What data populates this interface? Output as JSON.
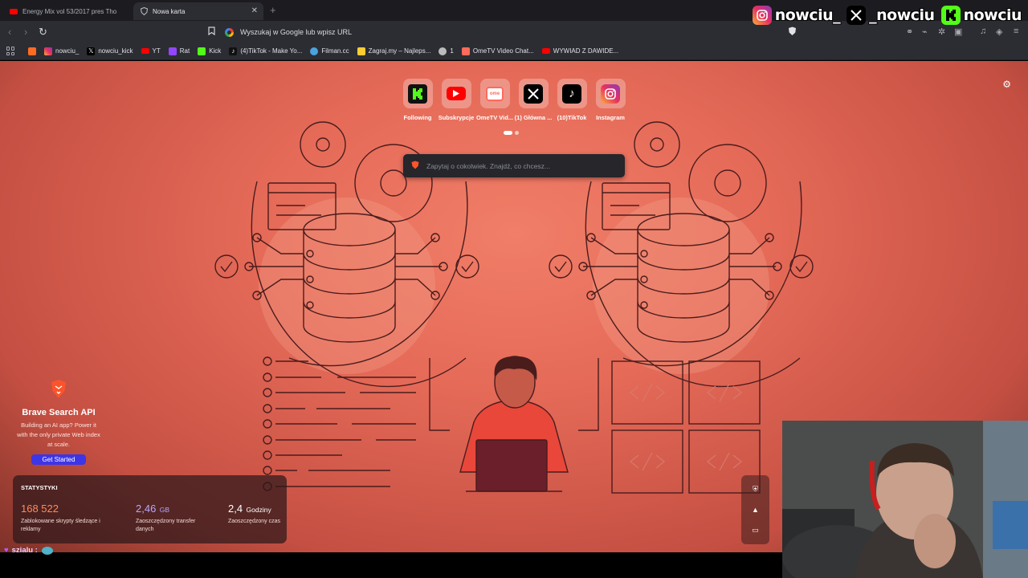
{
  "tabs": [
    {
      "title": "Energy Mix vol 53/2017 pres Tho",
      "active": false
    },
    {
      "title": "Nowa karta",
      "active": true
    }
  ],
  "overlay": {
    "instagram": "nowciu_",
    "x": "_nowciu",
    "kick": "nowciu"
  },
  "toolbar": {
    "url_placeholder": "Wyszukaj w Google lub wpisz URL"
  },
  "bookmarks": [
    {
      "label": "",
      "icon": "brave-news-icon",
      "color": "#ff6b23"
    },
    {
      "label": "nowciu_",
      "icon": "instagram-icon",
      "color": "#e1306c"
    },
    {
      "label": "nowciu_kick",
      "icon": "x-icon",
      "color": "#000000"
    },
    {
      "label": "YT",
      "icon": "youtube-icon",
      "color": "#ff0000"
    },
    {
      "label": "Rat",
      "icon": "twitch-icon",
      "color": "#9146ff"
    },
    {
      "label": "Kick",
      "icon": "kick-icon",
      "color": "#53fc18"
    },
    {
      "label": "(4)TikTok - Make Yo...",
      "icon": "tiktok-icon",
      "color": "#111111"
    },
    {
      "label": "Filman.cc",
      "icon": "filman-icon",
      "color": "#4aa3df"
    },
    {
      "label": "Zagraj.my – Najleps...",
      "icon": "zagraj-icon",
      "color": "#ffcc33"
    },
    {
      "label": "1",
      "icon": "globe-icon",
      "color": "#bbbbbb"
    },
    {
      "label": "OmeTV Video Chat...",
      "icon": "ometv-icon",
      "color": "#ff6b5b"
    },
    {
      "label": "WYWIAD Z DAWIDE...",
      "icon": "youtube-icon",
      "color": "#ff0000"
    }
  ],
  "top_sites": [
    {
      "label": "Following",
      "icon": "kick-icon"
    },
    {
      "label": "Subskrypcje",
      "icon": "youtube-icon"
    },
    {
      "label": "OmeTV Vid...",
      "icon": "ometv-icon"
    },
    {
      "label": "(1) Główna ...",
      "icon": "x-icon"
    },
    {
      "label": "(10)TikTok",
      "icon": "tiktok-icon"
    },
    {
      "label": "Instagram",
      "icon": "instagram-icon"
    }
  ],
  "ask": {
    "placeholder": "Zapytaj o cokolwiek. Znajdź, co chcesz..."
  },
  "brave_api": {
    "title": "Brave Search API",
    "description": "Building an AI app? Power it with the only private Web index at scale.",
    "cta": "Get Started"
  },
  "stats": {
    "heading": "STATYSTYKI",
    "items": [
      {
        "value": "168 522",
        "unit": "",
        "label": "Zablokowane skrypty śledzące i reklamy",
        "color": "#ff8a5c"
      },
      {
        "value": "2,46",
        "unit": "GB",
        "label": "Zaoszczędzony transfer danych",
        "color": "#b8a8ff"
      },
      {
        "value": "2,4",
        "unit": "Godziny",
        "label": "Zaoszczędzony czas",
        "color": "#ffffff"
      }
    ]
  },
  "chat": {
    "text": "szialu :"
  },
  "colors": {
    "accent_red": "#e56a58",
    "brave_blue": "#3d35e8"
  }
}
